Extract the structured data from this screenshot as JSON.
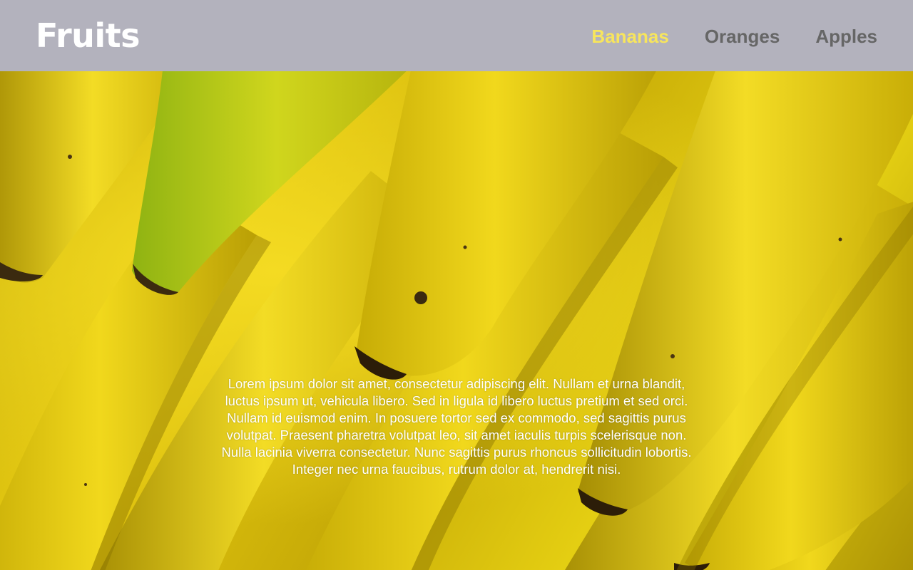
{
  "header": {
    "brand": "Fruits",
    "nav": [
      {
        "label": "Bananas",
        "active": true
      },
      {
        "label": "Oranges",
        "active": false
      },
      {
        "label": "Apples",
        "active": false
      }
    ]
  },
  "hero": {
    "image": "bananas-photo",
    "text": "Lorem ipsum dolor sit amet, consectetur adipiscing elit. Nullam et urna blandit, luctus ipsum ut, vehicula libero. Sed in ligula id libero luctus pretium et sed orci. Nullam id euismod enim. In posuere tortor sed ex commodo, sed sagittis purus volutpat. Praesent pharetra volutpat leo, sit amet iaculis turpis scelerisque non. Nulla lacinia viverra consectetur. Nunc sagittis purus rhoncus sollicitudin lobortis. Integer nec urna faucibus, rutrum dolor at, hendrerit nisi."
  },
  "colors": {
    "header_bg": "#b3b2bd",
    "brand": "#ffffff",
    "nav_active": "#f7e55d",
    "nav_inactive": "#666666",
    "banana": "#ecd318"
  }
}
